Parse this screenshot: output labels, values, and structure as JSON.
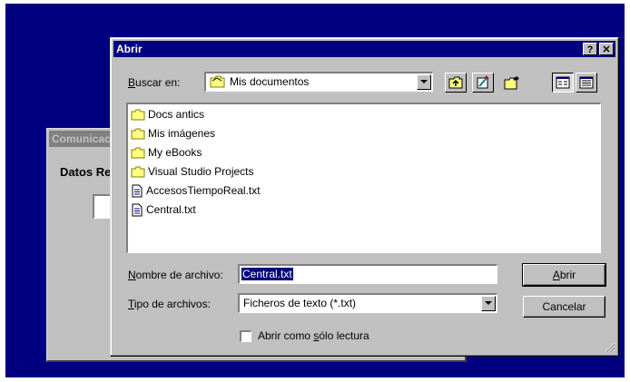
{
  "background_window": {
    "title": "Comunicación",
    "label": "Datos Recibidos"
  },
  "dialog": {
    "title": "Abrir",
    "help_label": "?",
    "close_label": "✕",
    "look_in": {
      "label_prefix": "B",
      "label_rest": "uscar en:",
      "value": "Mis documentos"
    },
    "files": [
      {
        "name": "Docs antics",
        "kind": "folder"
      },
      {
        "name": "Mis imágenes",
        "kind": "folder"
      },
      {
        "name": "My eBooks",
        "kind": "folder"
      },
      {
        "name": "Visual Studio Projects",
        "kind": "folder"
      },
      {
        "name": "AccesosTiempoReal.txt",
        "kind": "text-file"
      },
      {
        "name": "Central.txt",
        "kind": "text-file"
      }
    ],
    "file_name": {
      "label_prefix": "N",
      "label_rest": "ombre de archivo:",
      "value": "Central.txt"
    },
    "file_type": {
      "label_prefix": "T",
      "label_rest": "ipo de archivos:",
      "value": "Ficheros de texto (*.txt)"
    },
    "readonly": {
      "label_before": "Abrir como ",
      "label_accel": "s",
      "label_after": "ólo lectura",
      "checked": false
    },
    "open_label_accel": "A",
    "open_label_rest": "brir",
    "cancel_label": "Cancelar"
  },
  "colors": {
    "desktop": "#000080",
    "title_active": "#000080",
    "title_inactive": "#808080",
    "face": "#c0c0c0"
  }
}
